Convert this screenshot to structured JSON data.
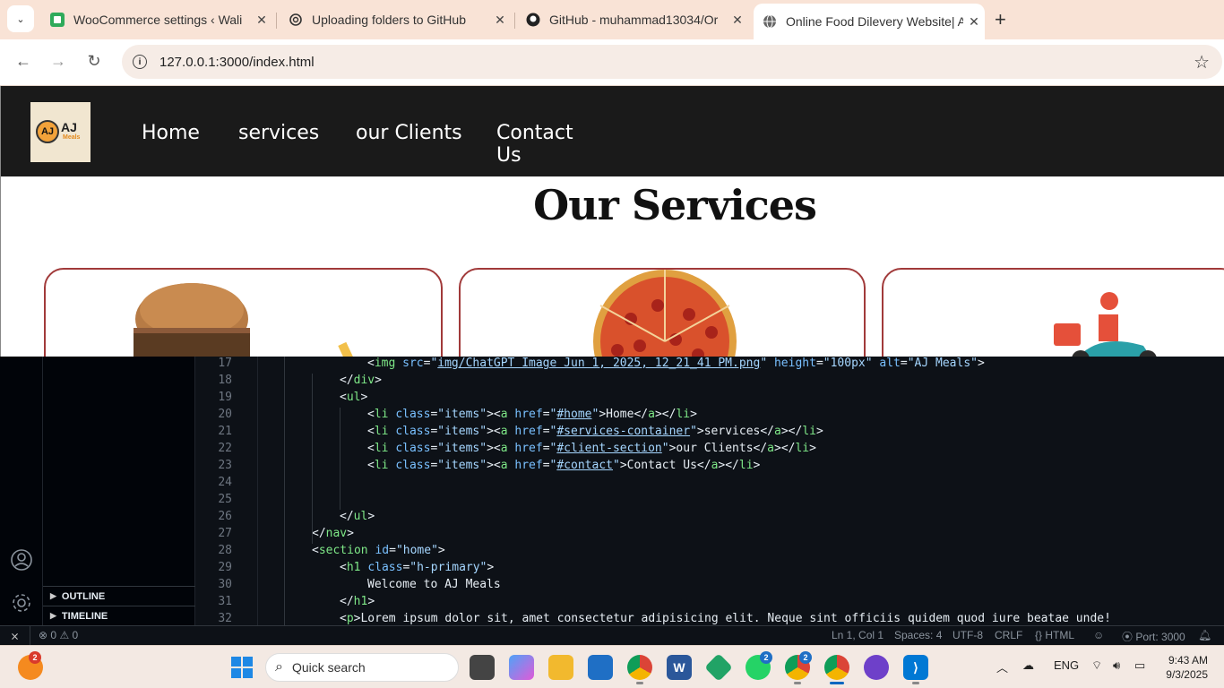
{
  "browser": {
    "tabs": [
      {
        "title": "WooCommerce settings ‹ Wali",
        "icon": "woocommerce-icon",
        "color": "#3cb371"
      },
      {
        "title": "Uploading folders to GitHub",
        "icon": "chatgpt-icon"
      },
      {
        "title": "GitHub - muhammad13034/Or",
        "icon": "github-icon"
      },
      {
        "title": "Online Food Dilevery Website| A",
        "icon": "globe-icon",
        "active": true
      }
    ],
    "url": "127.0.0.1:3000/index.html"
  },
  "site": {
    "logo": {
      "mark": "AJ",
      "name": "AJ",
      "sub": "Meals"
    },
    "nav": [
      "Home",
      "services",
      "our Clients",
      "Contact Us"
    ],
    "section_title": "Our Services"
  },
  "editor": {
    "side_sections": [
      "OUTLINE",
      "TIMELINE"
    ],
    "lines": [
      {
        "n": "17",
        "indent": 3,
        "tokens": [
          [
            "pun",
            "<"
          ],
          [
            "tag",
            "img"
          ],
          [
            "pun",
            " "
          ],
          [
            "attr",
            "src"
          ],
          [
            "pun",
            "="
          ],
          [
            "str",
            "\""
          ],
          [
            "link",
            "img/ChatGPT Image Jun 1, 2025, 12_21_41 PM.png"
          ],
          [
            "str",
            "\""
          ],
          [
            "pun",
            " "
          ],
          [
            "attr",
            "height"
          ],
          [
            "pun",
            "="
          ],
          [
            "str",
            "\"100px\""
          ],
          [
            "pun",
            " "
          ],
          [
            "attr",
            "alt"
          ],
          [
            "pun",
            "="
          ],
          [
            "str",
            "\"AJ Meals\""
          ],
          [
            "pun",
            ">"
          ]
        ]
      },
      {
        "n": "18",
        "indent": 2,
        "tokens": [
          [
            "pun",
            "</"
          ],
          [
            "tag",
            "div"
          ],
          [
            "pun",
            ">"
          ]
        ]
      },
      {
        "n": "19",
        "indent": 2,
        "tokens": [
          [
            "pun",
            "<"
          ],
          [
            "tag",
            "ul"
          ],
          [
            "pun",
            ">"
          ]
        ]
      },
      {
        "n": "20",
        "indent": 3,
        "tokens": [
          [
            "pun",
            "<"
          ],
          [
            "tag",
            "li"
          ],
          [
            "pun",
            " "
          ],
          [
            "attr",
            "class"
          ],
          [
            "pun",
            "="
          ],
          [
            "str",
            "\"items\""
          ],
          [
            "pun",
            ">"
          ],
          [
            "pun",
            "<"
          ],
          [
            "tag",
            "a"
          ],
          [
            "pun",
            " "
          ],
          [
            "attr",
            "href"
          ],
          [
            "pun",
            "="
          ],
          [
            "str",
            "\""
          ],
          [
            "link",
            "#home"
          ],
          [
            "str",
            "\""
          ],
          [
            "pun",
            ">"
          ],
          [
            "txt",
            "Home"
          ],
          [
            "pun",
            "</"
          ],
          [
            "tag",
            "a"
          ],
          [
            "pun",
            "></"
          ],
          [
            "tag",
            "li"
          ],
          [
            "pun",
            ">"
          ]
        ]
      },
      {
        "n": "21",
        "indent": 3,
        "tokens": [
          [
            "pun",
            "<"
          ],
          [
            "tag",
            "li"
          ],
          [
            "pun",
            " "
          ],
          [
            "attr",
            "class"
          ],
          [
            "pun",
            "="
          ],
          [
            "str",
            "\"items\""
          ],
          [
            "pun",
            ">"
          ],
          [
            "pun",
            "<"
          ],
          [
            "tag",
            "a"
          ],
          [
            "pun",
            " "
          ],
          [
            "attr",
            "href"
          ],
          [
            "pun",
            "="
          ],
          [
            "str",
            "\""
          ],
          [
            "link",
            "#services-container"
          ],
          [
            "str",
            "\""
          ],
          [
            "pun",
            ">"
          ],
          [
            "txt",
            "services"
          ],
          [
            "pun",
            "</"
          ],
          [
            "tag",
            "a"
          ],
          [
            "pun",
            "></"
          ],
          [
            "tag",
            "li"
          ],
          [
            "pun",
            ">"
          ]
        ]
      },
      {
        "n": "22",
        "indent": 3,
        "tokens": [
          [
            "pun",
            "<"
          ],
          [
            "tag",
            "li"
          ],
          [
            "pun",
            " "
          ],
          [
            "attr",
            "class"
          ],
          [
            "pun",
            "="
          ],
          [
            "str",
            "\"items\""
          ],
          [
            "pun",
            ">"
          ],
          [
            "pun",
            "<"
          ],
          [
            "tag",
            "a"
          ],
          [
            "pun",
            " "
          ],
          [
            "attr",
            "href"
          ],
          [
            "pun",
            "="
          ],
          [
            "str",
            "\""
          ],
          [
            "link",
            "#client-section"
          ],
          [
            "str",
            "\""
          ],
          [
            "pun",
            ">"
          ],
          [
            "txt",
            "our Clients"
          ],
          [
            "pun",
            "</"
          ],
          [
            "tag",
            "a"
          ],
          [
            "pun",
            "></"
          ],
          [
            "tag",
            "li"
          ],
          [
            "pun",
            ">"
          ]
        ]
      },
      {
        "n": "23",
        "indent": 3,
        "tokens": [
          [
            "pun",
            "<"
          ],
          [
            "tag",
            "li"
          ],
          [
            "pun",
            " "
          ],
          [
            "attr",
            "class"
          ],
          [
            "pun",
            "="
          ],
          [
            "str",
            "\"items\""
          ],
          [
            "pun",
            ">"
          ],
          [
            "pun",
            "<"
          ],
          [
            "tag",
            "a"
          ],
          [
            "pun",
            " "
          ],
          [
            "attr",
            "href"
          ],
          [
            "pun",
            "="
          ],
          [
            "str",
            "\""
          ],
          [
            "link",
            "#contact"
          ],
          [
            "str",
            "\""
          ],
          [
            "pun",
            ">"
          ],
          [
            "txt",
            "Contact Us"
          ],
          [
            "pun",
            "</"
          ],
          [
            "tag",
            "a"
          ],
          [
            "pun",
            "></"
          ],
          [
            "tag",
            "li"
          ],
          [
            "pun",
            ">"
          ]
        ]
      },
      {
        "n": "24",
        "indent": 0,
        "tokens": []
      },
      {
        "n": "25",
        "indent": 0,
        "tokens": []
      },
      {
        "n": "26",
        "indent": 2,
        "tokens": [
          [
            "pun",
            "</"
          ],
          [
            "tag",
            "ul"
          ],
          [
            "pun",
            ">"
          ]
        ]
      },
      {
        "n": "27",
        "indent": 1,
        "tokens": [
          [
            "pun",
            "</"
          ],
          [
            "tag",
            "nav"
          ],
          [
            "pun",
            ">"
          ]
        ]
      },
      {
        "n": "28",
        "indent": 1,
        "tokens": [
          [
            "pun",
            "<"
          ],
          [
            "tag",
            "section"
          ],
          [
            "pun",
            " "
          ],
          [
            "attr",
            "id"
          ],
          [
            "pun",
            "="
          ],
          [
            "str",
            "\"home\""
          ],
          [
            "pun",
            ">"
          ]
        ]
      },
      {
        "n": "29",
        "indent": 2,
        "tokens": [
          [
            "pun",
            "<"
          ],
          [
            "tag",
            "h1"
          ],
          [
            "pun",
            " "
          ],
          [
            "attr",
            "class"
          ],
          [
            "pun",
            "="
          ],
          [
            "str",
            "\"h-primary\""
          ],
          [
            "pun",
            ">"
          ]
        ]
      },
      {
        "n": "30",
        "indent": 3,
        "tokens": [
          [
            "txt",
            "Welcome to AJ Meals"
          ]
        ]
      },
      {
        "n": "31",
        "indent": 2,
        "tokens": [
          [
            "pun",
            "</"
          ],
          [
            "tag",
            "h1"
          ],
          [
            "pun",
            ">"
          ]
        ]
      },
      {
        "n": "32",
        "indent": 2,
        "tokens": [
          [
            "pun",
            "<"
          ],
          [
            "tag",
            "p"
          ],
          [
            "pun",
            ">"
          ],
          [
            "txt",
            "Lorem ipsum dolor sit, amet consectetur adipisicing elit. Neque sint officiis quidem quod iure beatae unde!"
          ]
        ]
      }
    ]
  },
  "status": {
    "errors": "0",
    "warnings": "0",
    "position": "Ln 1, Col 1",
    "spaces": "Spaces: 4",
    "encoding": "UTF-8",
    "eol": "CRLF",
    "language": "HTML",
    "port": "Port: 3000"
  },
  "taskbar": {
    "search_placeholder": "Quick search",
    "lang": "ENG",
    "time": "9:43 AM",
    "date": "9/3/2025",
    "badges": {
      "browser": "2",
      "whatsapp": "2"
    }
  }
}
